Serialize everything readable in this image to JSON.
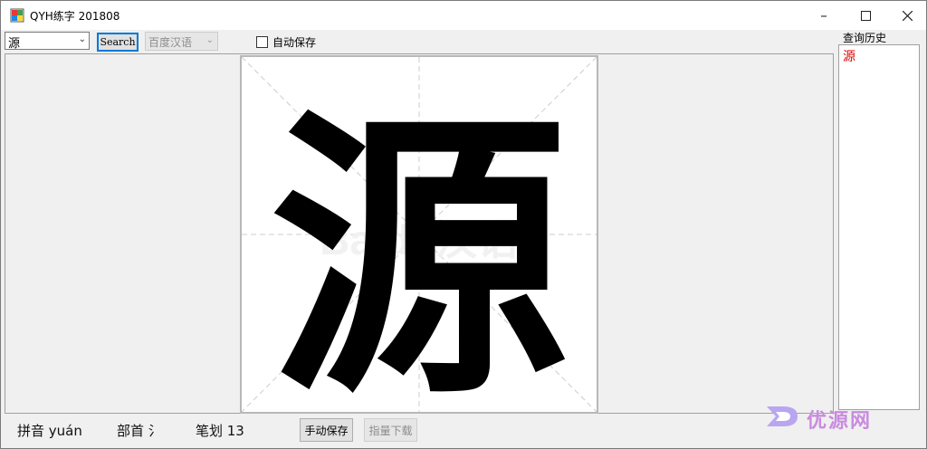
{
  "window": {
    "title": "QYH练字 201808"
  },
  "toolbar": {
    "char_value": "源",
    "search_label": "Search",
    "source_value": "百度汉语",
    "autosave_label": "自动保存",
    "autosave_checked": false
  },
  "canvas": {
    "character": "源",
    "bg_watermark": "Baidu汉语"
  },
  "history": {
    "label": "查询历史",
    "items": [
      "源"
    ]
  },
  "info": {
    "pinyin": "拼音 yuán",
    "radical": "部首 氵",
    "strokes": "笔划 13"
  },
  "actions": {
    "manual_save_label": "手动保存",
    "download_label": "指量下载"
  },
  "watermark": {
    "text": "优源网"
  },
  "colors": {
    "accent": "#0078d7",
    "history_item": "#e00000",
    "watermark": "#c98be0"
  }
}
